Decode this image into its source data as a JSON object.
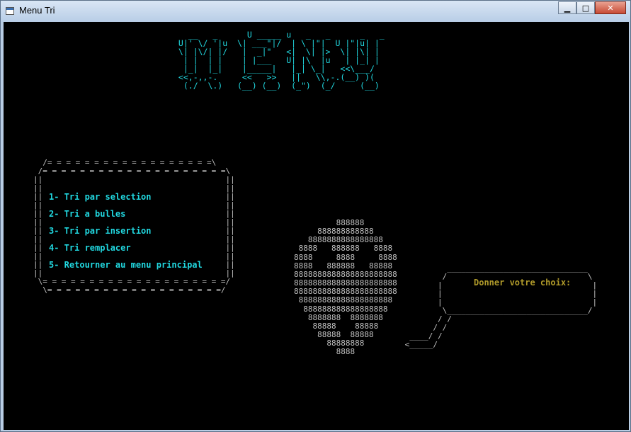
{
  "window": {
    "title": "Menu Tri",
    "minimize_glyph": "▁",
    "maximize_glyph": "□",
    "close_glyph": "✕"
  },
  "console": {
    "banner_ascii": "   __   _      U _____ u   _   _      _   _   \n U|' \\/ '|u  \\| ___\"|/  | \\ |\"|  U |\"|u| |  \n \\| |\\/| |/   |  _|\"   <|  \\| |>  \\| |\\| |  \n  | |  | |    | |___   U| |\\  |u   | |_| |  \n  |_|  |_|    |_____|   |_| \\_|   <<\\___/   \n <<,-,,-.     <<   >>   ||   \\\\,-.(__) )(   \n  (./  \\.)   (__) (__)  (_\")  (_/     (__)  ",
    "menu_frame": "  /= = = = = = = = = = = = = = = = = =\\\n /= = = = = = = = = = = = = = = = = = = =\\\n||                                       ||\n||                                       ||\n||                                       ||\n||                                       ||\n||                                       ||\n||                                       ||\n||                                       ||\n||                                       ||\n||                                       ||\n||                                       ||\n||                                       ||\n||                                       ||\n \\= = = = = = = = = = = = = = = = = = = =/\n  \\= = = = = = = = = = = = = = = = = = =/",
    "menu_items": [
      "1- Tri par selection",
      "2- Tri a bulles",
      "3- Tri par insertion",
      "4- Tri remplacer",
      "5- Retourner au menu principal"
    ],
    "face_ascii": "         888888\n     888888888888\n   8888888888888888\n 8888   888888   8888\n8888     8888     8888\n8888   888888   88888\n8888888888888888888888\n8888888888888888888888\n8888888888888888888888\n 88888888888888888888\n  888888888888888888\n   8888888  8888888\n    88888    88888\n     88888  88888\n       88888888\n         8888",
    "bubble_ascii": "          ______________________________\n         /                              \\\n        |                                |\n        |                                |\n        |                                |\n         \\______________________________/\n        / /\n       / /\n  ____/ /\n <_____/",
    "prompt": "Donner votre choix:"
  },
  "colors": {
    "console_bg": "#000000",
    "cyan_text": "#21d8e0",
    "frame_text": "#c0c0c0",
    "prompt_text": "#b09a2a"
  }
}
